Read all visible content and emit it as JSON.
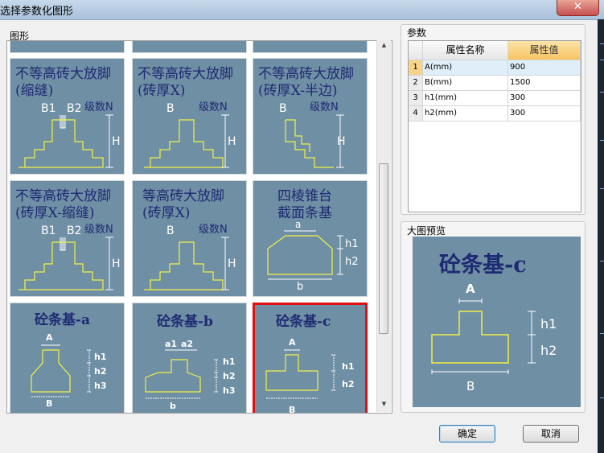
{
  "window": {
    "title": "选择参数化图形",
    "close_label": "✕"
  },
  "gallery": {
    "group_label": "图形",
    "tiles": [
      {
        "title_lines": [
          "不等高砖大放脚",
          "(缩缝)"
        ],
        "labels": {
          "b1": "B1",
          "b2": "B2",
          "n": "级数N",
          "h": "H"
        }
      },
      {
        "title_lines": [
          "不等高砖大放脚",
          "(砖厚X)"
        ],
        "labels": {
          "b": "B",
          "n": "级数N",
          "h": "H"
        }
      },
      {
        "title_lines": [
          "不等高砖大放脚",
          "(砖厚X-半边)"
        ],
        "labels": {
          "b": "B",
          "n": "级数N",
          "h": "H"
        }
      },
      {
        "title_lines": [
          "不等高砖大放脚",
          "(砖厚X-缩缝)"
        ],
        "labels": {
          "b1": "B1",
          "b2": "B2",
          "n": "级数N",
          "h": "H"
        }
      },
      {
        "title_lines": [
          "等高砖大放脚",
          "(砖厚X)"
        ],
        "labels": {
          "b": "B",
          "n": "级数N",
          "h": "H"
        }
      },
      {
        "title_lines": [
          "四棱锥台",
          "截面条基"
        ],
        "labels": {
          "a": "a",
          "h1": "h1",
          "h2": "h2",
          "b": "b"
        }
      },
      {
        "title_lines": [
          "砼条基-a"
        ],
        "labels": {
          "a": "A",
          "h1": "h1",
          "h2": "h2",
          "h3": "h3",
          "b": "B"
        }
      },
      {
        "title_lines": [
          "砼条基-b"
        ],
        "labels": {
          "a1": "a1",
          "a2": "a2",
          "h1": "h1",
          "h2": "h2",
          "h3": "h3",
          "b": "b"
        }
      },
      {
        "title_lines": [
          "砼条基-c"
        ],
        "labels": {
          "a": "A",
          "h1": "h1",
          "h2": "h2",
          "b": "B"
        },
        "selected": true
      }
    ]
  },
  "params": {
    "group_label": "参数",
    "headers": {
      "name": "属性名称",
      "value": "属性值"
    },
    "rows": [
      {
        "num": "1",
        "name": "A(mm)",
        "value": "900"
      },
      {
        "num": "2",
        "name": "B(mm)",
        "value": "1500"
      },
      {
        "num": "3",
        "name": "h1(mm)",
        "value": "300"
      },
      {
        "num": "4",
        "name": "h2(mm)",
        "value": "300"
      }
    ]
  },
  "preview": {
    "group_label": "大图预览",
    "title": "砼条基-c",
    "labels": {
      "a": "A",
      "h1": "h1",
      "h2": "h2",
      "b": "B"
    }
  },
  "buttons": {
    "ok": "确定",
    "cancel": "取消"
  },
  "colors": {
    "tile_bg": "#6f8fa5",
    "tile_ink": "#1e2a72",
    "drawing": "#f2f244",
    "selected_border": "#e01010"
  }
}
